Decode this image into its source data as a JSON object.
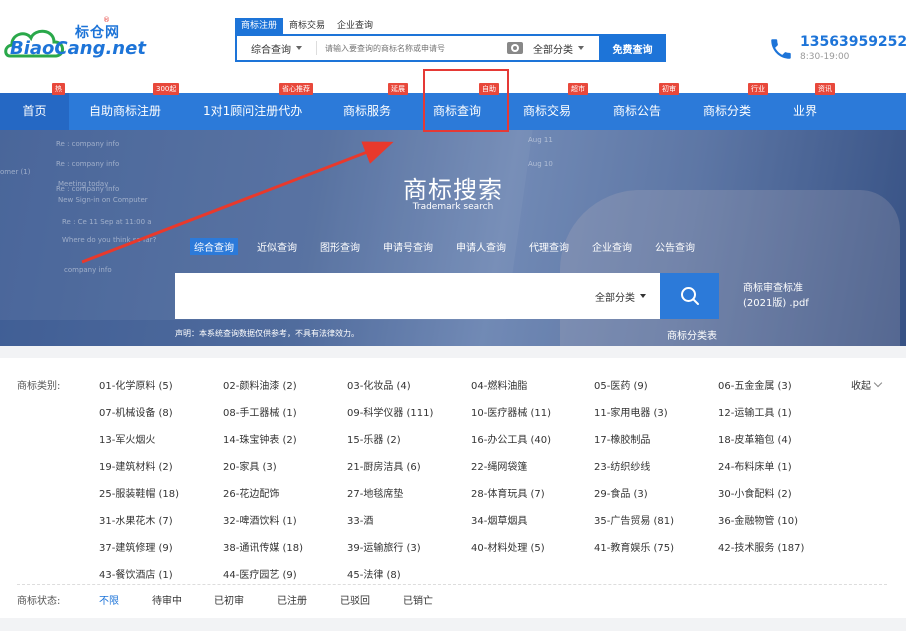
{
  "logo": {
    "cn": "标仓网",
    "en_prefix": "Biao",
    "en_suffix": "Cang.net",
    "reg": "®"
  },
  "header_search": {
    "tabs": [
      "商标注册",
      "商标交易",
      "企业查询"
    ],
    "type": "综合查询",
    "placeholder": "请输入要查询的商标名称或申请号",
    "category": "全部分类",
    "button": "免费查询"
  },
  "contact": {
    "phone": "13563959252",
    "hours": "8:30-19:00"
  },
  "nav": [
    {
      "label": "首页",
      "badge": "热"
    },
    {
      "label": "自助商标注册",
      "badge": "300起"
    },
    {
      "label": "1对1顾问注册代办",
      "badge": "省心推荐"
    },
    {
      "label": "商标服务",
      "badge": "延展"
    },
    {
      "label": "商标查询",
      "badge": "自助"
    },
    {
      "label": "商标交易",
      "badge": "超市"
    },
    {
      "label": "商标公告",
      "badge": "初审"
    },
    {
      "label": "商标分类",
      "badge": "行业"
    },
    {
      "label": "业界",
      "badge": "资讯"
    }
  ],
  "hero": {
    "title": "商标搜索",
    "subtitle": "Trademark search",
    "tabs": [
      "综合查询",
      "近似查询",
      "图形查询",
      "申请号查询",
      "申请人查询",
      "代理查询",
      "企业查询",
      "公告查询"
    ],
    "category": "全部分类",
    "disclaimer": "声明：本系统查询数据仅供参考，不具有法律效力。",
    "pdf_line1": "商标审查标准",
    "pdf_line2": "(2021版) .pdf",
    "class_link": "商标分类表",
    "background_text": [
      "Re : company info",
      "Re : company info",
      "Re : company info",
      "omer (1)",
      "Meeting today",
      "New Sign-in on Computer",
      "Re : Ce 11 Sep at 11:00 a",
      "Where do you think so far?",
      "company info",
      "Aug 11",
      "Aug 10"
    ]
  },
  "categories": {
    "label": "商标类别:",
    "collapse": "收起",
    "items": [
      "01-化学原料 (5)",
      "02-颜料油漆 (2)",
      "03-化妆品 (4)",
      "04-燃料油脂",
      "05-医药 (9)",
      "06-五金金属 (3)",
      "07-机械设备 (8)",
      "08-手工器械 (1)",
      "09-科学仪器 (111)",
      "10-医疗器械 (11)",
      "11-家用电器 (3)",
      "12-运输工具 (1)",
      "13-军火烟火",
      "14-珠宝钟表 (2)",
      "15-乐器 (2)",
      "16-办公工具 (40)",
      "17-橡胶制品",
      "18-皮革箱包 (4)",
      "19-建筑材料 (2)",
      "20-家具 (3)",
      "21-厨房洁具 (6)",
      "22-绳网袋篷",
      "23-纺织纱线",
      "24-布料床单 (1)",
      "25-服装鞋帽 (18)",
      "26-花边配饰",
      "27-地毯席垫",
      "28-体育玩具 (7)",
      "29-食品 (3)",
      "30-小食配料 (2)",
      "31-水果花木 (7)",
      "32-啤酒饮料 (1)",
      "33-酒",
      "34-烟草烟具",
      "35-广告贸易 (81)",
      "36-金融物管 (10)",
      "37-建筑修理 (9)",
      "38-通讯传媒 (18)",
      "39-运输旅行 (3)",
      "40-材料处理 (5)",
      "41-教育娱乐 (75)",
      "42-技术服务 (187)",
      "43-餐饮酒店 (1)",
      "44-医疗园艺 (9)",
      "45-法律 (8)"
    ]
  },
  "status": {
    "label": "商标状态:",
    "items": [
      "不限",
      "待审中",
      "已初审",
      "已注册",
      "已驳回",
      "已销亡"
    ]
  },
  "colors": {
    "brand": "#1d74d8",
    "nav": "#2c7ad9",
    "badge": "#e8483b",
    "highlight": "#e53935"
  }
}
